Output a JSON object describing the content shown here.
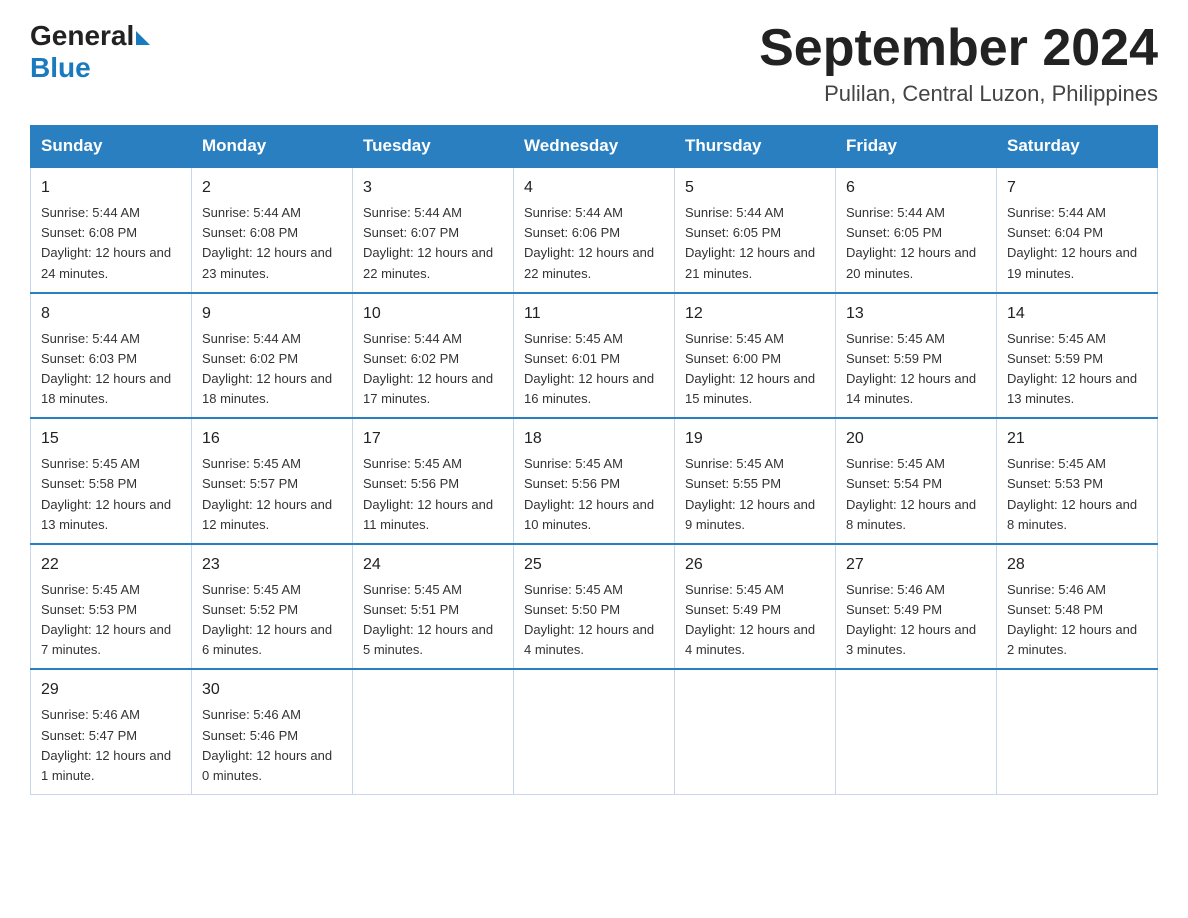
{
  "header": {
    "logo_general": "General",
    "logo_blue": "Blue",
    "month_title": "September 2024",
    "location": "Pulilan, Central Luzon, Philippines"
  },
  "weekdays": [
    "Sunday",
    "Monday",
    "Tuesday",
    "Wednesday",
    "Thursday",
    "Friday",
    "Saturday"
  ],
  "weeks": [
    [
      {
        "day": "1",
        "sunrise": "5:44 AM",
        "sunset": "6:08 PM",
        "daylight": "12 hours and 24 minutes."
      },
      {
        "day": "2",
        "sunrise": "5:44 AM",
        "sunset": "6:08 PM",
        "daylight": "12 hours and 23 minutes."
      },
      {
        "day": "3",
        "sunrise": "5:44 AM",
        "sunset": "6:07 PM",
        "daylight": "12 hours and 22 minutes."
      },
      {
        "day": "4",
        "sunrise": "5:44 AM",
        "sunset": "6:06 PM",
        "daylight": "12 hours and 22 minutes."
      },
      {
        "day": "5",
        "sunrise": "5:44 AM",
        "sunset": "6:05 PM",
        "daylight": "12 hours and 21 minutes."
      },
      {
        "day": "6",
        "sunrise": "5:44 AM",
        "sunset": "6:05 PM",
        "daylight": "12 hours and 20 minutes."
      },
      {
        "day": "7",
        "sunrise": "5:44 AM",
        "sunset": "6:04 PM",
        "daylight": "12 hours and 19 minutes."
      }
    ],
    [
      {
        "day": "8",
        "sunrise": "5:44 AM",
        "sunset": "6:03 PM",
        "daylight": "12 hours and 18 minutes."
      },
      {
        "day": "9",
        "sunrise": "5:44 AM",
        "sunset": "6:02 PM",
        "daylight": "12 hours and 18 minutes."
      },
      {
        "day": "10",
        "sunrise": "5:44 AM",
        "sunset": "6:02 PM",
        "daylight": "12 hours and 17 minutes."
      },
      {
        "day": "11",
        "sunrise": "5:45 AM",
        "sunset": "6:01 PM",
        "daylight": "12 hours and 16 minutes."
      },
      {
        "day": "12",
        "sunrise": "5:45 AM",
        "sunset": "6:00 PM",
        "daylight": "12 hours and 15 minutes."
      },
      {
        "day": "13",
        "sunrise": "5:45 AM",
        "sunset": "5:59 PM",
        "daylight": "12 hours and 14 minutes."
      },
      {
        "day": "14",
        "sunrise": "5:45 AM",
        "sunset": "5:59 PM",
        "daylight": "12 hours and 13 minutes."
      }
    ],
    [
      {
        "day": "15",
        "sunrise": "5:45 AM",
        "sunset": "5:58 PM",
        "daylight": "12 hours and 13 minutes."
      },
      {
        "day": "16",
        "sunrise": "5:45 AM",
        "sunset": "5:57 PM",
        "daylight": "12 hours and 12 minutes."
      },
      {
        "day": "17",
        "sunrise": "5:45 AM",
        "sunset": "5:56 PM",
        "daylight": "12 hours and 11 minutes."
      },
      {
        "day": "18",
        "sunrise": "5:45 AM",
        "sunset": "5:56 PM",
        "daylight": "12 hours and 10 minutes."
      },
      {
        "day": "19",
        "sunrise": "5:45 AM",
        "sunset": "5:55 PM",
        "daylight": "12 hours and 9 minutes."
      },
      {
        "day": "20",
        "sunrise": "5:45 AM",
        "sunset": "5:54 PM",
        "daylight": "12 hours and 8 minutes."
      },
      {
        "day": "21",
        "sunrise": "5:45 AM",
        "sunset": "5:53 PM",
        "daylight": "12 hours and 8 minutes."
      }
    ],
    [
      {
        "day": "22",
        "sunrise": "5:45 AM",
        "sunset": "5:53 PM",
        "daylight": "12 hours and 7 minutes."
      },
      {
        "day": "23",
        "sunrise": "5:45 AM",
        "sunset": "5:52 PM",
        "daylight": "12 hours and 6 minutes."
      },
      {
        "day": "24",
        "sunrise": "5:45 AM",
        "sunset": "5:51 PM",
        "daylight": "12 hours and 5 minutes."
      },
      {
        "day": "25",
        "sunrise": "5:45 AM",
        "sunset": "5:50 PM",
        "daylight": "12 hours and 4 minutes."
      },
      {
        "day": "26",
        "sunrise": "5:45 AM",
        "sunset": "5:49 PM",
        "daylight": "12 hours and 4 minutes."
      },
      {
        "day": "27",
        "sunrise": "5:46 AM",
        "sunset": "5:49 PM",
        "daylight": "12 hours and 3 minutes."
      },
      {
        "day": "28",
        "sunrise": "5:46 AM",
        "sunset": "5:48 PM",
        "daylight": "12 hours and 2 minutes."
      }
    ],
    [
      {
        "day": "29",
        "sunrise": "5:46 AM",
        "sunset": "5:47 PM",
        "daylight": "12 hours and 1 minute."
      },
      {
        "day": "30",
        "sunrise": "5:46 AM",
        "sunset": "5:46 PM",
        "daylight": "12 hours and 0 minutes."
      },
      null,
      null,
      null,
      null,
      null
    ]
  ]
}
